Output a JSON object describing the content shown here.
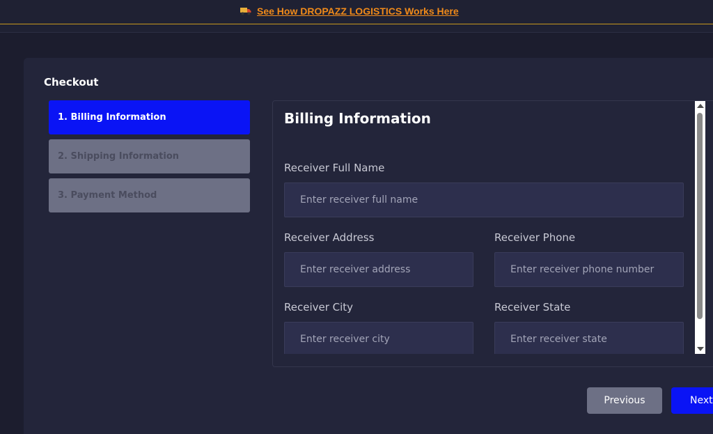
{
  "banner": {
    "icon": "truck-icon",
    "link_text": "See How DROPAZZ LOGISTICS Works Here",
    "link_color": "#f08a1a"
  },
  "checkout": {
    "title": "Checkout",
    "steps": [
      {
        "label": "1. Billing Information",
        "active": true
      },
      {
        "label": "2. Shipping Information",
        "active": false
      },
      {
        "label": "3. Payment Method",
        "active": false
      }
    ]
  },
  "form": {
    "title": "Billing Information",
    "fields": {
      "full_name": {
        "label": "Receiver Full Name",
        "placeholder": "Enter receiver full name",
        "value": ""
      },
      "address": {
        "label": "Receiver Address",
        "placeholder": "Enter receiver address",
        "value": ""
      },
      "phone": {
        "label": "Receiver Phone",
        "placeholder": "Enter receiver phone number",
        "value": ""
      },
      "city": {
        "label": "Receiver City",
        "placeholder": "Enter receiver city",
        "value": ""
      },
      "state": {
        "label": "Receiver State",
        "placeholder": "Enter receiver state",
        "value": ""
      }
    }
  },
  "buttons": {
    "previous": "Previous",
    "next": "Next"
  },
  "colors": {
    "accent": "#0a14f5",
    "background": "#1c1d2e",
    "card": "#23253a",
    "inactive_step": "#6d7085"
  }
}
